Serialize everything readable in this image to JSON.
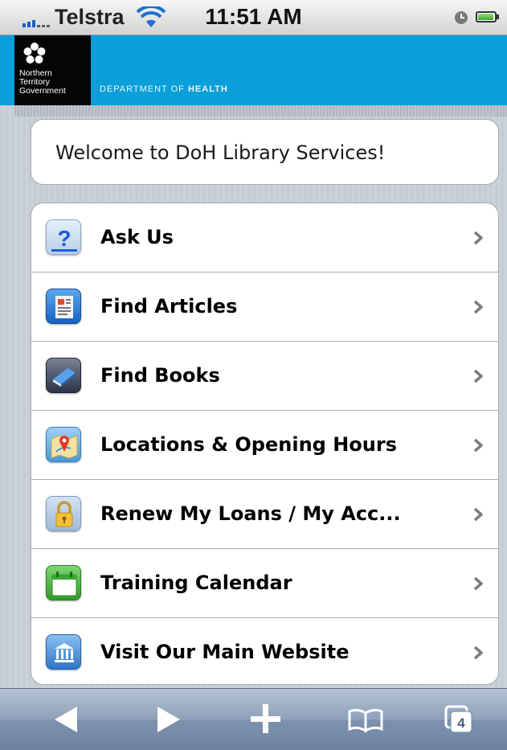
{
  "status_bar": {
    "carrier": "Telstra",
    "time": "11:51 AM"
  },
  "header": {
    "logo_lines": [
      "Northern",
      "Territory",
      "Government"
    ],
    "department_prefix": "DEPARTMENT OF",
    "department_name": "HEALTH",
    "brand_color": "#0a9fd8"
  },
  "welcome": {
    "text": "Welcome to DoH Library Services!"
  },
  "menu": {
    "items": [
      {
        "label": "Ask Us",
        "icon": "help-icon"
      },
      {
        "label": "Find Articles",
        "icon": "article-icon"
      },
      {
        "label": "Find Books",
        "icon": "book-icon"
      },
      {
        "label": "Locations & Opening Hours",
        "icon": "map-pin-icon"
      },
      {
        "label": "Renew My Loans / My Acc...",
        "icon": "lock-icon"
      },
      {
        "label": "Training Calendar",
        "icon": "calendar-icon"
      },
      {
        "label": "Visit Our Main Website",
        "icon": "museum-icon"
      }
    ]
  },
  "toolbar": {
    "tabs_count": "4",
    "buttons": [
      "back-icon",
      "forward-icon",
      "add-icon",
      "bookmarks-icon",
      "tabs-icon"
    ]
  }
}
